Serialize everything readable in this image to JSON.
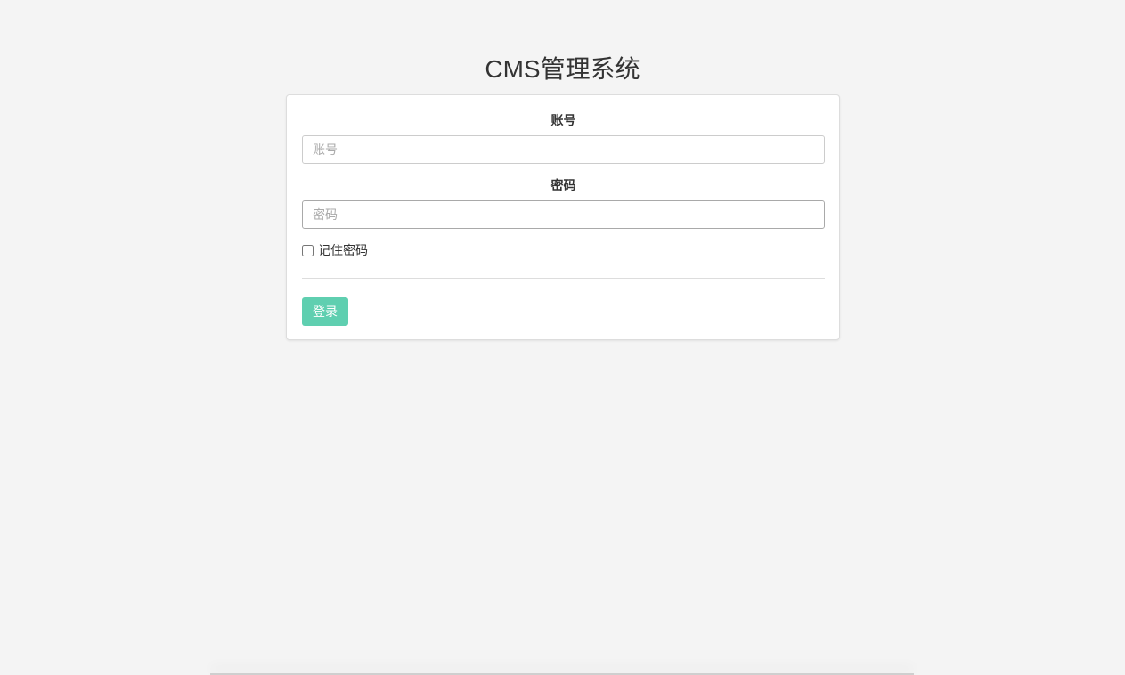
{
  "page": {
    "title": "CMS管理系统"
  },
  "form": {
    "account_label": "账号",
    "account_placeholder": "账号",
    "account_value": "",
    "password_label": "密码",
    "password_placeholder": "密码",
    "password_value": "",
    "remember_label": "记住密码",
    "remember_checked": false,
    "login_label": "登录"
  },
  "colors": {
    "background": "#f4f4f4",
    "primary_button": "#5fcfb0",
    "text": "#333333"
  }
}
